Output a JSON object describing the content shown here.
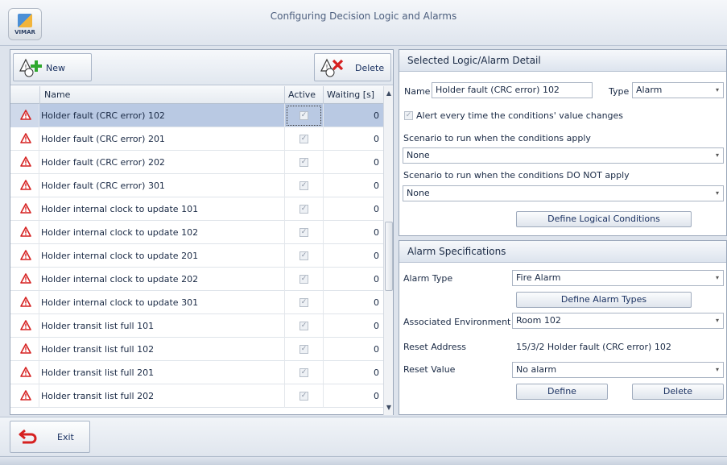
{
  "window": {
    "title": "Configuring Decision Logic and Alarms",
    "logo_text": "VIMAR"
  },
  "toolbar": {
    "new_label": "New",
    "delete_label": "Delete"
  },
  "table": {
    "columns": {
      "name": "Name",
      "active": "Active",
      "waiting": "Waiting [s]"
    },
    "rows": [
      {
        "name": "Holder fault (CRC error) 102",
        "active": true,
        "waiting": "0"
      },
      {
        "name": "Holder fault (CRC error) 201",
        "active": true,
        "waiting": "0"
      },
      {
        "name": "Holder fault (CRC error) 202",
        "active": true,
        "waiting": "0"
      },
      {
        "name": "Holder fault (CRC error) 301",
        "active": true,
        "waiting": "0"
      },
      {
        "name": "Holder internal clock to update 101",
        "active": true,
        "waiting": "0"
      },
      {
        "name": "Holder internal clock to update 102",
        "active": true,
        "waiting": "0"
      },
      {
        "name": "Holder internal clock to update 201",
        "active": true,
        "waiting": "0"
      },
      {
        "name": "Holder internal clock to update 202",
        "active": true,
        "waiting": "0"
      },
      {
        "name": "Holder internal clock to update 301",
        "active": true,
        "waiting": "0"
      },
      {
        "name": "Holder transit list full 101",
        "active": true,
        "waiting": "0"
      },
      {
        "name": "Holder transit list full 102",
        "active": true,
        "waiting": "0"
      },
      {
        "name": "Holder transit list full 201",
        "active": true,
        "waiting": "0"
      },
      {
        "name": "Holder transit list full 202",
        "active": true,
        "waiting": "0"
      }
    ]
  },
  "detail": {
    "header": "Selected Logic/Alarm Detail",
    "name_label": "Name",
    "name_value": "Holder fault (CRC error) 102",
    "type_label": "Type",
    "type_value": "Alarm",
    "alert_label": "Alert every time the conditions' value changes",
    "scenario_apply_label": "Scenario to run when the conditions apply",
    "scenario_apply_value": "None",
    "scenario_not_apply_label": "Scenario to run when the conditions DO NOT apply",
    "scenario_not_apply_value": "None",
    "define_conditions_label": "Define Logical Conditions"
  },
  "alarm": {
    "header": "Alarm Specifications",
    "type_label": "Alarm Type",
    "type_value": "Fire Alarm",
    "define_types_label": "Define Alarm Types",
    "env_label": "Associated Environment",
    "env_value": "Room 102",
    "reset_address_label": "Reset Address",
    "reset_address_value": "15/3/2 Holder fault (CRC error) 102",
    "reset_value_label": "Reset Value",
    "reset_value_value": "No alarm",
    "define_label": "Define",
    "delete_label": "Delete"
  },
  "bottom": {
    "exit_label": "Exit"
  },
  "colors": {
    "selected_row": "#b9c9e3",
    "alarm_icon": "#d62020",
    "new_plus": "#2ea82e",
    "delete_x": "#d62020"
  }
}
